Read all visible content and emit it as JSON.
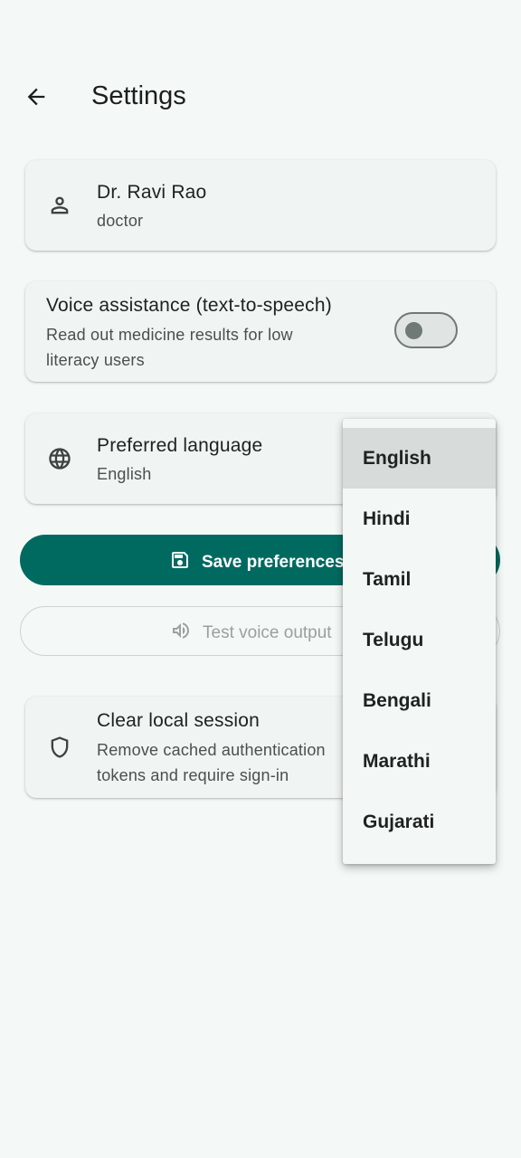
{
  "header": {
    "title": "Settings"
  },
  "profile": {
    "name": "Dr. Ravi Rao",
    "role": "doctor"
  },
  "voice": {
    "title": "Voice assistance (text-to-speech)",
    "description_line1": "Read out medicine results for low",
    "description_line2": "literacy users",
    "enabled": false
  },
  "language": {
    "title": "Preferred language",
    "value": "English"
  },
  "actions": {
    "save_label": "Save preferences",
    "test_label": "Test voice output"
  },
  "session": {
    "title": "Clear local session",
    "description_line1": "Remove cached authentication",
    "description_line2": "tokens and require sign-in"
  },
  "language_menu": {
    "options": [
      "English",
      "Hindi",
      "Tamil",
      "Telugu",
      "Bengali",
      "Marathi",
      "Gujarati"
    ],
    "selected": "English"
  },
  "colors": {
    "primary": "#006a60",
    "background": "#f4f9f7",
    "card": "#f0f4f2"
  },
  "icons": {
    "back": "arrow-back-icon",
    "profile": "person-icon",
    "language": "globe-icon",
    "save": "save-icon",
    "test": "speaker-icon",
    "session": "shield-icon"
  }
}
